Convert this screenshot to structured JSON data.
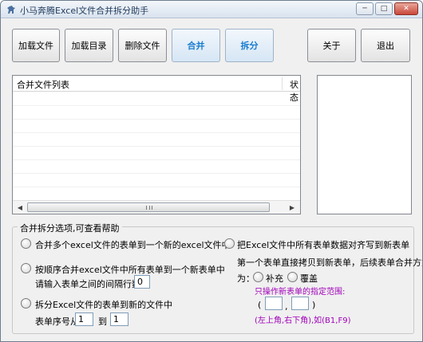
{
  "window": {
    "title": "小马奔腾Excel文件合并拆分助手",
    "min": "─",
    "max": "□",
    "close": "✕"
  },
  "toolbar": {
    "load_file": "加载文件",
    "load_dir": "加载目录",
    "delete_file": "删除文件",
    "merge": "合并",
    "split": "拆分",
    "about": "关于",
    "exit": "退出"
  },
  "file_list": {
    "col_name": "合并文件列表",
    "col_status": "状态",
    "scroll_left": "◀",
    "scroll_right": "▶"
  },
  "options": {
    "title": "合并拆分选项,可查看帮助",
    "opt1": "合并多个excel文件的表单到一个新的excel文件中",
    "opt2": "按顺序合并excel文件中所有表单到一个新表单中",
    "opt2_gap_label": "请输入表单之间的间隔行数",
    "opt2_gap_value": "0",
    "opt3": "拆分Excel文件的表单到新的文件中",
    "opt3_from_label": "表单序号从",
    "opt3_from_value": "1",
    "opt3_to_label": "到",
    "opt3_to_value": "1",
    "opt4": "把Excel文件中所有表单数据对齐写到新表单",
    "opt4_desc": "第一个表单直接拷贝到新表单，后续表单合并方式",
    "opt4_mode_label": "为：",
    "mode_fill": "补充",
    "mode_overwrite": "覆盖",
    "range_hint": "只操作新表单的指定范围:",
    "range_open": "(",
    "range_comma": ",",
    "range_close": ")",
    "range_example": "(左上角,右下角),如(B1,F9)"
  }
}
